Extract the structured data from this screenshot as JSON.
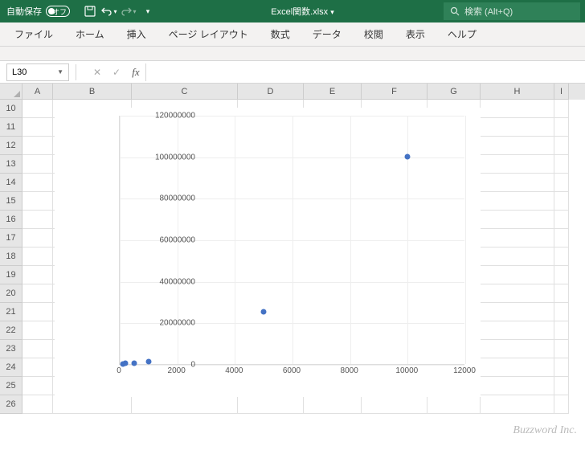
{
  "titlebar": {
    "autosave_label": "自動保存",
    "autosave_state": "オフ",
    "filename": "Excel関数.xlsx",
    "search_placeholder": "検索 (Alt+Q)"
  },
  "ribbon": {
    "tabs": [
      "ファイル",
      "ホーム",
      "挿入",
      "ページ レイアウト",
      "数式",
      "データ",
      "校閲",
      "表示",
      "ヘルプ"
    ]
  },
  "formula_bar": {
    "name_box": "L30",
    "formula": ""
  },
  "grid": {
    "columns": [
      {
        "label": "A",
        "width": 38
      },
      {
        "label": "B",
        "width": 98
      },
      {
        "label": "C",
        "width": 132
      },
      {
        "label": "D",
        "width": 82
      },
      {
        "label": "E",
        "width": 72
      },
      {
        "label": "F",
        "width": 82
      },
      {
        "label": "G",
        "width": 66
      },
      {
        "label": "H",
        "width": 92
      },
      {
        "label": "I",
        "width": 18
      }
    ],
    "rows": [
      "10",
      "11",
      "12",
      "13",
      "14",
      "15",
      "16",
      "17",
      "18",
      "19",
      "20",
      "21",
      "22",
      "23",
      "24",
      "25",
      "26"
    ]
  },
  "chart_data": {
    "type": "scatter",
    "x": [
      100,
      200,
      500,
      1000,
      5000,
      10000
    ],
    "y": [
      100000,
      200000,
      500000,
      1000000,
      25000000,
      100000000
    ],
    "xlim": [
      0,
      12000
    ],
    "ylim": [
      0,
      120000000
    ],
    "xticks": [
      0,
      2000,
      4000,
      6000,
      8000,
      10000,
      12000
    ],
    "yticks": [
      0,
      20000000,
      40000000,
      60000000,
      80000000,
      100000000,
      120000000
    ],
    "title": "",
    "xlabel": "",
    "ylabel": ""
  },
  "watermark": "Buzzword Inc."
}
